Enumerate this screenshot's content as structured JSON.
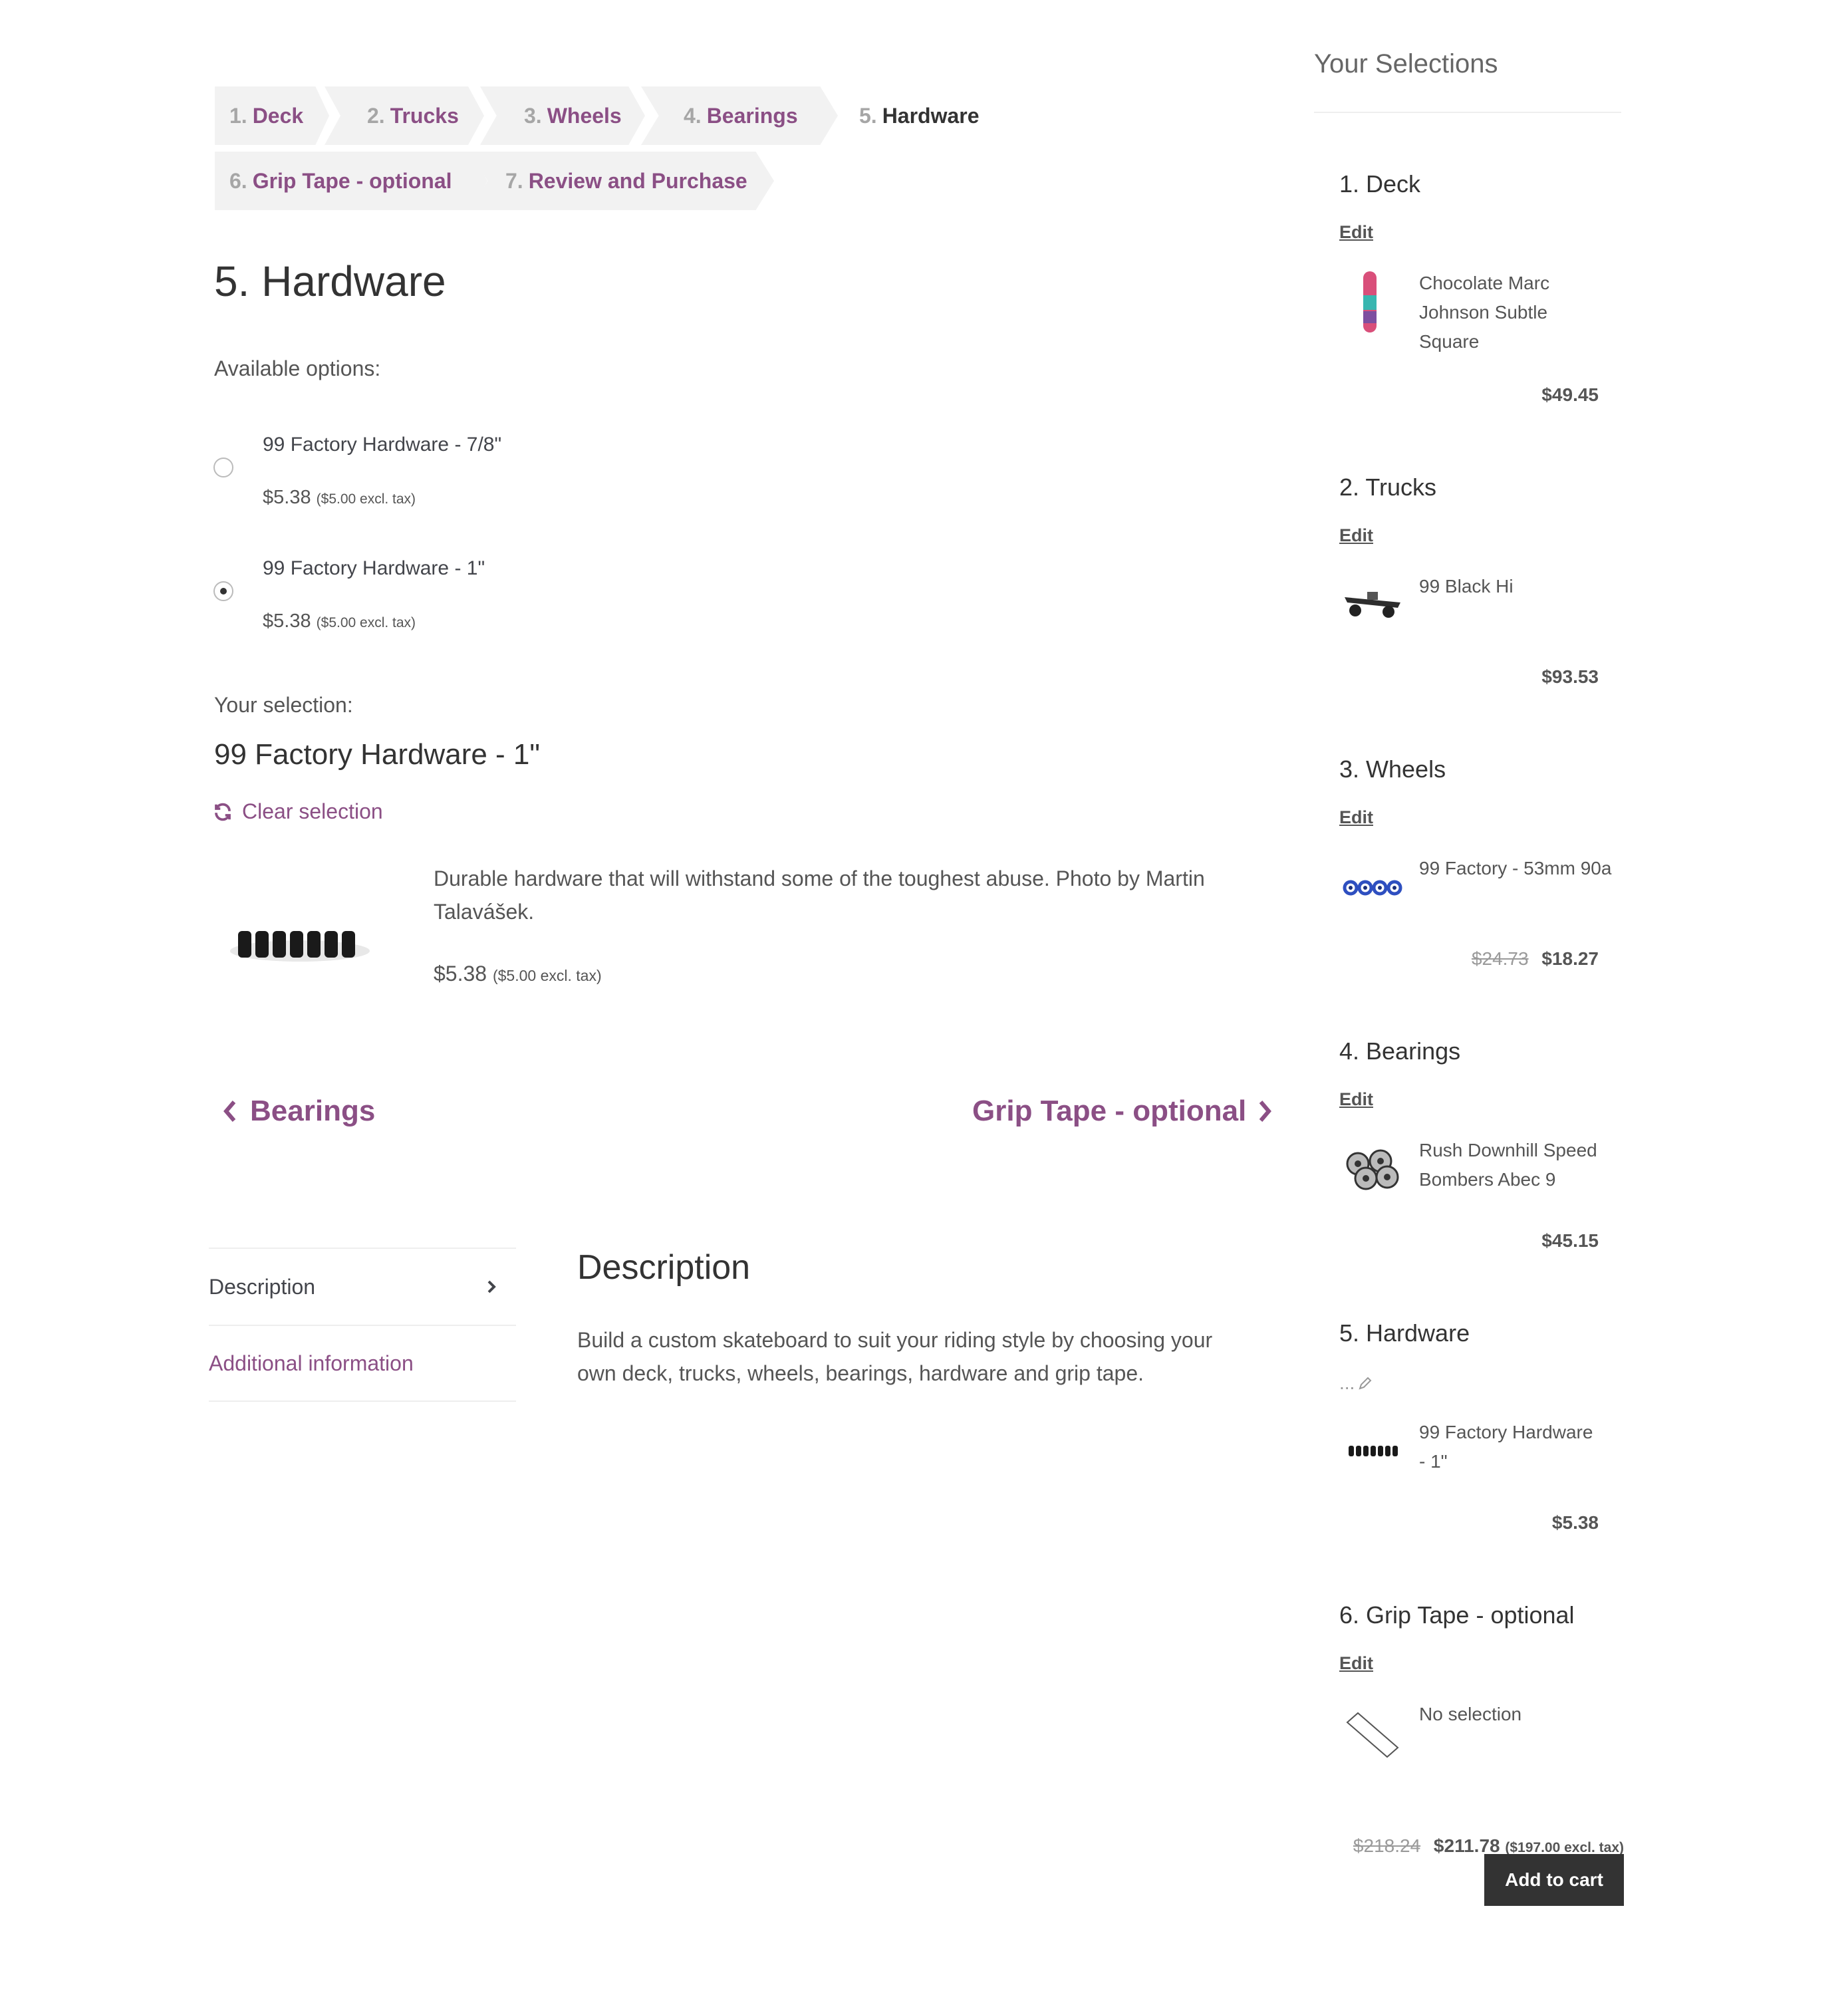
{
  "steps": [
    {
      "num": "1.",
      "label": "Deck"
    },
    {
      "num": "2.",
      "label": "Trucks"
    },
    {
      "num": "3.",
      "label": "Wheels"
    },
    {
      "num": "4.",
      "label": "Bearings"
    },
    {
      "num": "5.",
      "label": "Hardware"
    },
    {
      "num": "6.",
      "label": "Grip Tape - optional"
    },
    {
      "num": "7.",
      "label": "Review and Purchase"
    }
  ],
  "main": {
    "title": "5. Hardware",
    "available_label": "Available options:",
    "options": [
      {
        "name": "99 Factory Hardware - 7/8\"",
        "price": "$5.38",
        "excl": "($5.00 excl. tax)",
        "selected": false
      },
      {
        "name": "99 Factory Hardware - 1\"",
        "price": "$5.38",
        "excl": "($5.00 excl. tax)",
        "selected": true
      }
    ],
    "selection_label": "Your selection:",
    "selection_name": "99 Factory Hardware - 1\"",
    "clear_label": "Clear selection",
    "description": "Durable hardware that will withstand some of the toughest abuse. Photo by Martin Talavášek.",
    "desc_price": "$5.38",
    "desc_excl": "($5.00 excl. tax)",
    "prev_label": "Bearings",
    "next_label": "Grip Tape - optional"
  },
  "tabs": {
    "items": [
      "Description",
      "Additional information"
    ],
    "panel_title": "Description",
    "panel_text": "Build a custom skateboard to suit your riding style by choosing your own deck, trucks, wheels, bearings, hardware and grip tape."
  },
  "sidebar": {
    "title": "Your Selections",
    "edit_label": "Edit",
    "sections": [
      {
        "heading": "1. Deck",
        "name": "Chocolate Marc Johnson Subtle Square",
        "price": "$49.45",
        "old_price": ""
      },
      {
        "heading": "2. Trucks",
        "name": "99 Black Hi",
        "price": "$93.53",
        "old_price": ""
      },
      {
        "heading": "3. Wheels",
        "name": "99 Factory - 53mm 90a",
        "price": "$18.27",
        "old_price": "$24.73"
      },
      {
        "heading": "4. Bearings",
        "name": "Rush Downhill Speed Bombers Abec 9",
        "price": "$45.15",
        "old_price": ""
      },
      {
        "heading": "5. Hardware",
        "name": "99 Factory Hardware - 1\"",
        "price": "$5.38",
        "old_price": "",
        "edit_text": "..."
      },
      {
        "heading": "6. Grip Tape - optional",
        "name": "No selection",
        "price": "",
        "old_price": ""
      }
    ],
    "total_old": "$218.24",
    "total": "$211.78",
    "total_excl": "($197.00 excl. tax)",
    "add_to_cart": "Add to cart"
  },
  "colors": {
    "accent": "#8b4f85",
    "text": "#43454b",
    "button": "#333333"
  }
}
